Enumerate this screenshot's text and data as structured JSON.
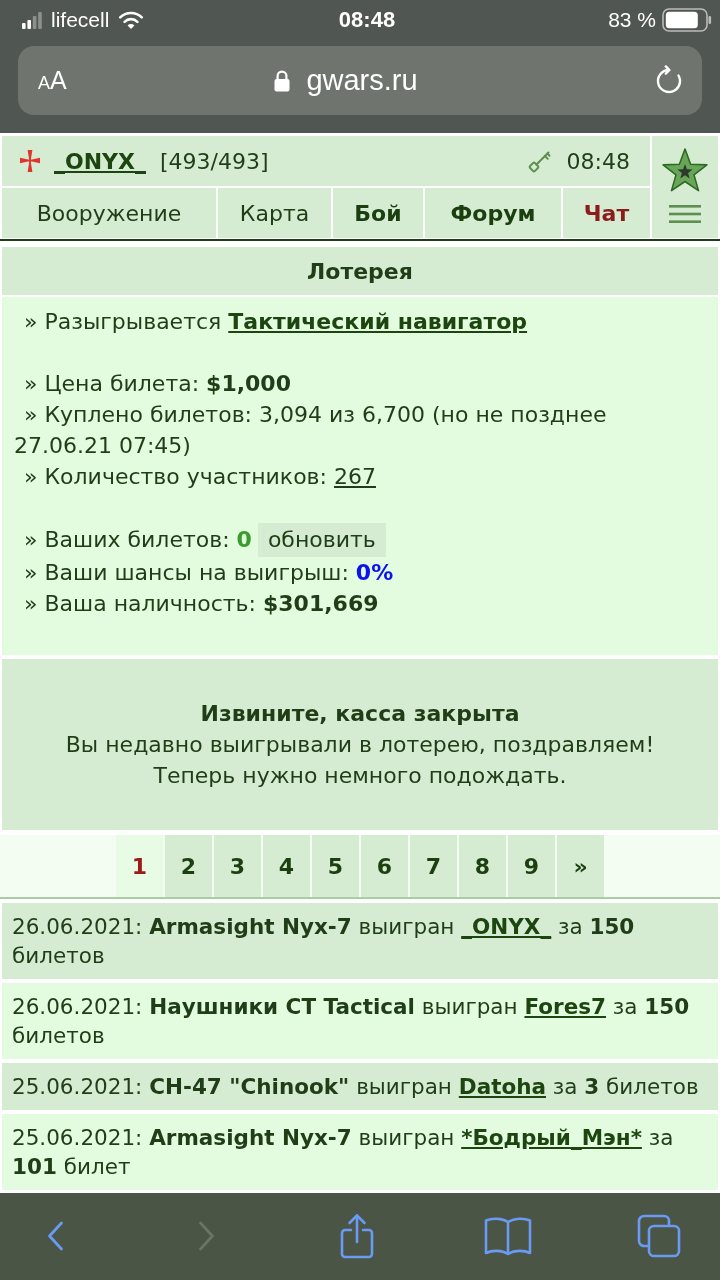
{
  "status_bar": {
    "carrier": "lifecell",
    "time": "08:48",
    "battery": "83 %"
  },
  "address_bar": {
    "text_size": "AA",
    "url": "gwars.ru"
  },
  "header": {
    "player": "_ONYX_",
    "hp": "[493/493]",
    "time": "08:48",
    "nav": [
      {
        "label": "Вооружение",
        "kind": "normal"
      },
      {
        "label": "Карта",
        "kind": "normal"
      },
      {
        "label": "Бой",
        "kind": "bold"
      },
      {
        "label": "Форум",
        "kind": "bold"
      },
      {
        "label": "Чат",
        "kind": "alert"
      }
    ]
  },
  "lottery": {
    "title": "Лотерея",
    "prize": {
      "label": "» Разыгрывается",
      "link": "Тактический навигатор"
    },
    "price": "» Цена билета: **$1,000**",
    "sold": "» Куплено билетов: 3,094 из 6,700 (но не позднее 27.06.21 07:45)",
    "participants": {
      "label": "» Количество участников:",
      "link": "267"
    },
    "tickets": {
      "label": "» Ваших билетов:",
      "value": "0",
      "button": "обновить"
    },
    "chance": {
      "label": "» Ваши шансы на выигрыш:",
      "value": "0%"
    },
    "cash": "» Ваша наличность: **$301,669**"
  },
  "notice": {
    "title": "Извините, касса закрыта",
    "text": "Вы недавно выигрывали в лотерею, поздравляем! Теперь нужно немного подождать."
  },
  "pagination": [
    {
      "label": "1",
      "selected": true
    },
    {
      "label": "2",
      "selected": false
    },
    {
      "label": "3",
      "selected": false
    },
    {
      "label": "4",
      "selected": false
    },
    {
      "label": "5",
      "selected": false
    },
    {
      "label": "6",
      "selected": false
    },
    {
      "label": "7",
      "selected": false
    },
    {
      "label": "8",
      "selected": false
    },
    {
      "label": "9",
      "selected": false
    },
    {
      "label": "»",
      "selected": false
    }
  ],
  "winners": [
    {
      "text": "26.06.2021: **Armasight Nyx-7** выигран",
      "winner": "_ONYX_",
      "tail": "за **150** билетов"
    },
    {
      "text": "26.06.2021: **Наушники CT Tactical** выигран",
      "winner": "Fores7",
      "tail": "за **150** билетов"
    },
    {
      "text": "25.06.2021: **CH-47 \"Chinook\"** выигран",
      "winner": "Datoha",
      "tail": "за **3** билетов"
    },
    {
      "text": "25.06.2021: **Armasight Nyx-7** выигран",
      "winner": "*Бодрый_Мэн*",
      "tail": "за **101** билет"
    }
  ],
  "browser_toolbar": [
    {
      "kind": "back",
      "disabled": false
    },
    {
      "kind": "forward",
      "disabled": true
    },
    {
      "kind": "share",
      "disabled": false
    },
    {
      "kind": "bookmarks",
      "disabled": false
    },
    {
      "kind": "tabs",
      "disabled": false
    }
  ]
}
